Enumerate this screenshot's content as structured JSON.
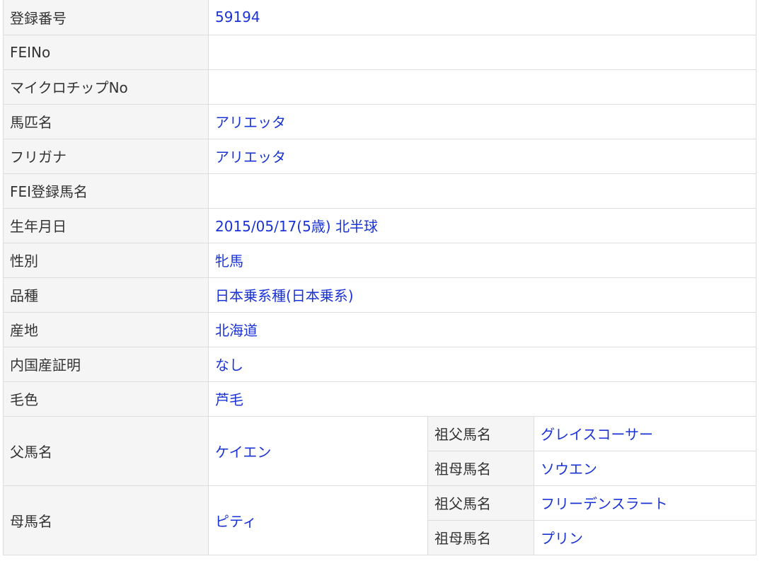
{
  "rows": [
    {
      "label": "登録番号",
      "value": "59194"
    },
    {
      "label": "FEINo",
      "value": ""
    },
    {
      "label": "マイクロチップNo",
      "value": ""
    },
    {
      "label": "馬匹名",
      "value": "アリエッタ"
    },
    {
      "label": "フリガナ",
      "value": "アリエッタ"
    },
    {
      "label": "FEI登録馬名",
      "value": ""
    },
    {
      "label": "生年月日",
      "value": "2015/05/17(5歳) 北半球"
    },
    {
      "label": "性別",
      "value": "牝馬"
    },
    {
      "label": "品種",
      "value": "日本乗系種(日本乗系)"
    },
    {
      "label": "産地",
      "value": "北海道"
    },
    {
      "label": "内国産証明",
      "value": "なし"
    },
    {
      "label": "毛色",
      "value": "芦毛"
    }
  ],
  "sire": {
    "label": "父馬名",
    "value": "ケイエン",
    "grandsire_label": "祖父馬名",
    "grandsire_value": "グレイスコーサー",
    "granddam_label": "祖母馬名",
    "granddam_value": "ソウエン"
  },
  "dam": {
    "label": "母馬名",
    "value": "ピティ",
    "grandsire_label": "祖父馬名",
    "grandsire_value": "フリーデンスラート",
    "granddam_label": "祖母馬名",
    "granddam_value": "プリン"
  },
  "colors": {
    "label_bg": "#f5f5f5",
    "link_text": "#1a33d6",
    "border": "#dddddd"
  }
}
